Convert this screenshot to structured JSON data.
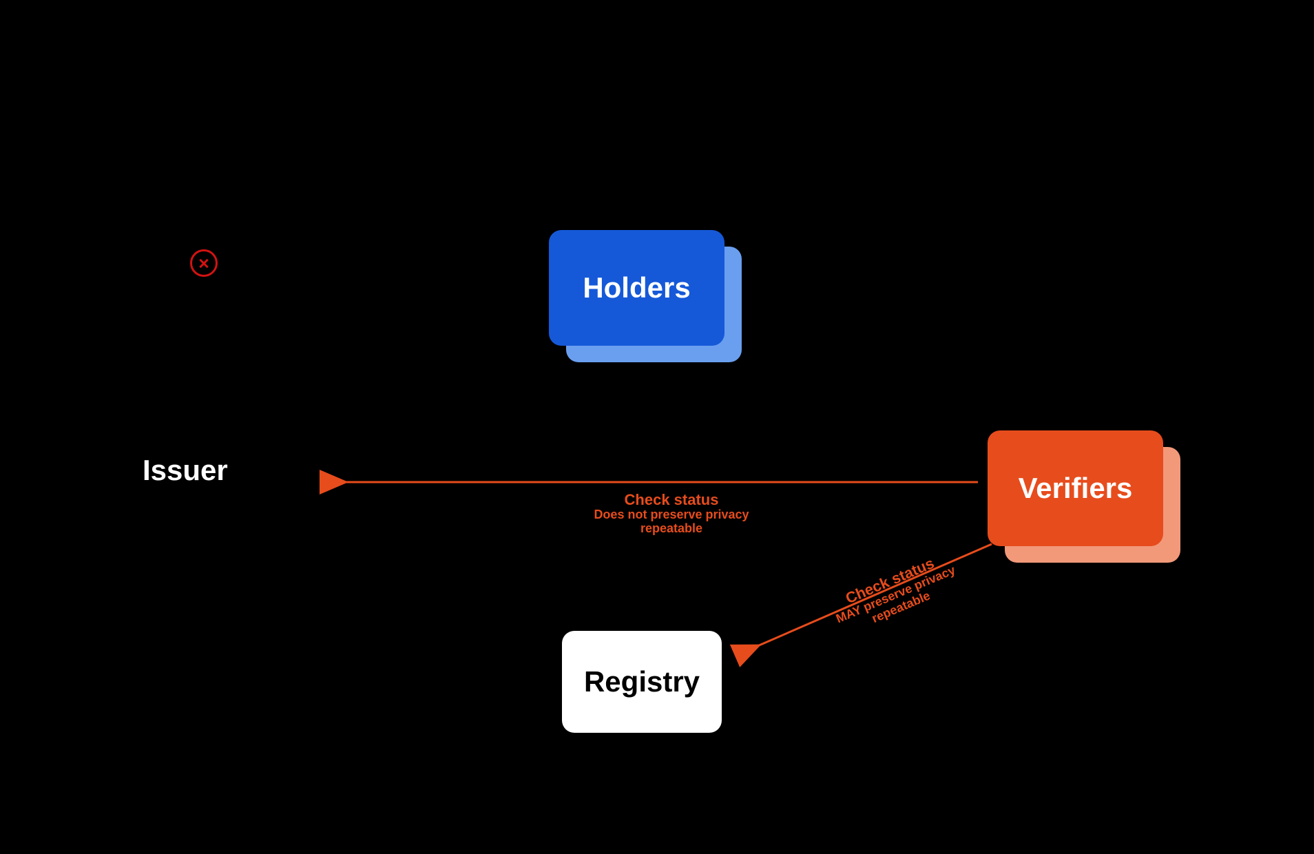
{
  "nodes": {
    "issuer": "Issuer",
    "holders": "Holders",
    "verifiers": "Verifiers",
    "registry": "Registry"
  },
  "edges": {
    "verifier_to_issuer": {
      "title": "Check status",
      "line2": "Does not preserve privacy",
      "line3": "repeatable"
    },
    "verifier_to_registry": {
      "title": "Check status",
      "line2": "MAY preserve privacy",
      "line3": "repeatable"
    }
  },
  "colors": {
    "background": "#000000",
    "issuer_text": "#ffffff",
    "holders_fill": "#1559d8",
    "holders_back_fill": "#6a9ff0",
    "verifiers_fill": "#e74c1c",
    "verifiers_back_fill": "#f2997a",
    "registry_fill": "#ffffff",
    "registry_text": "#000000",
    "arrow": "#e74c1c",
    "error_icon": "#d31212"
  }
}
